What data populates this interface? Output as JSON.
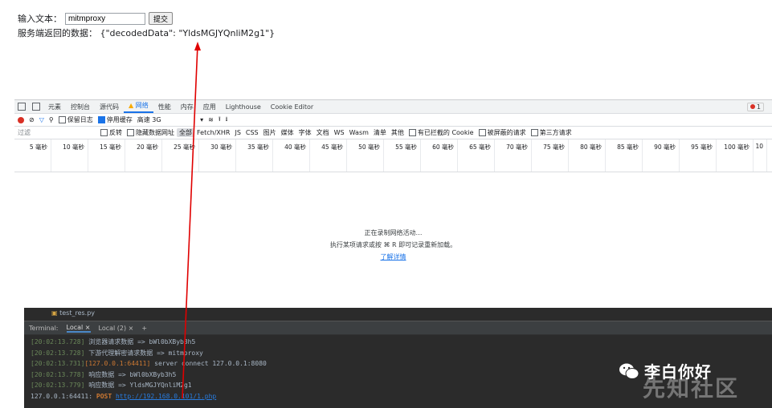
{
  "form": {
    "input_label": "输入文本：",
    "input_value": "mitmproxy",
    "submit_label": "提交",
    "response_label": "服务端返回的数据：",
    "response_value": "{\"decodedData\": \"YldsMGJYQnliM2g1\"}"
  },
  "devtools": {
    "tabs": [
      "元素",
      "控制台",
      "源代码",
      "网络",
      "性能",
      "内存",
      "应用",
      "Lighthouse",
      "Cookie Editor"
    ],
    "active_tab": "网络",
    "error_count": "1",
    "toolbar": {
      "preserve_log": "保留日志",
      "disable_cache": "停用缓存",
      "throttling": "高速 3G"
    },
    "filter": {
      "placeholder": "过滤",
      "invert": "反转",
      "hide_data_urls": "隐藏数据网址",
      "types": [
        "全部",
        "Fetch/XHR",
        "JS",
        "CSS",
        "图片",
        "媒体",
        "字体",
        "文档",
        "WS",
        "Wasm",
        "清单",
        "其他"
      ],
      "blocked_cookies": "有已拦截的 Cookie",
      "blocked_requests": "被屏蔽的请求",
      "third_party": "第三方请求"
    },
    "timeline_ticks": [
      "5 毫秒",
      "10 毫秒",
      "15 毫秒",
      "20 毫秒",
      "25 毫秒",
      "30 毫秒",
      "35 毫秒",
      "40 毫秒",
      "45 毫秒",
      "50 毫秒",
      "55 毫秒",
      "60 毫秒",
      "65 毫秒",
      "70 毫秒",
      "75 毫秒",
      "80 毫秒",
      "85 毫秒",
      "90 毫秒",
      "95 毫秒",
      "100 毫秒",
      "10"
    ],
    "empty_state": {
      "line1": "正在录制网络活动…",
      "line2": "执行某项请求或按 ⌘ R 即可记录重新加载。",
      "link": "了解详情"
    }
  },
  "ide": {
    "file": "test_res.py",
    "terminal_label": "Terminal:",
    "terminal_tabs": [
      "Local",
      "Local (2)"
    ],
    "add_tab": "+",
    "lines": [
      {
        "ts": "[20:02:13.728]",
        "text": " 浏览器请求数据 => bWl0bXByb3h5"
      },
      {
        "ts": "[20:02:13.728]",
        "text": " 下游代理解密请求数据 => mitmproxy"
      },
      {
        "ts": "[20:02:13.731]",
        "addr": "[127.0.0.1:64411]",
        "text": " server connect 127.0.0.1:8080"
      },
      {
        "ts": "[20:02:13.778]",
        "text": " 响应数据 => bWl0bXByb3h5"
      },
      {
        "ts": "[20:02:13.779]",
        "text": " 响应数据 => YldsMGJYQnliM2g1"
      }
    ],
    "last_line": {
      "prefix": "127.0.0.1:64411: ",
      "method": "POST",
      "url": "http://192.168.0.101/1.php"
    }
  },
  "watermark": {
    "name": "李白你好",
    "site": "先知社区"
  }
}
